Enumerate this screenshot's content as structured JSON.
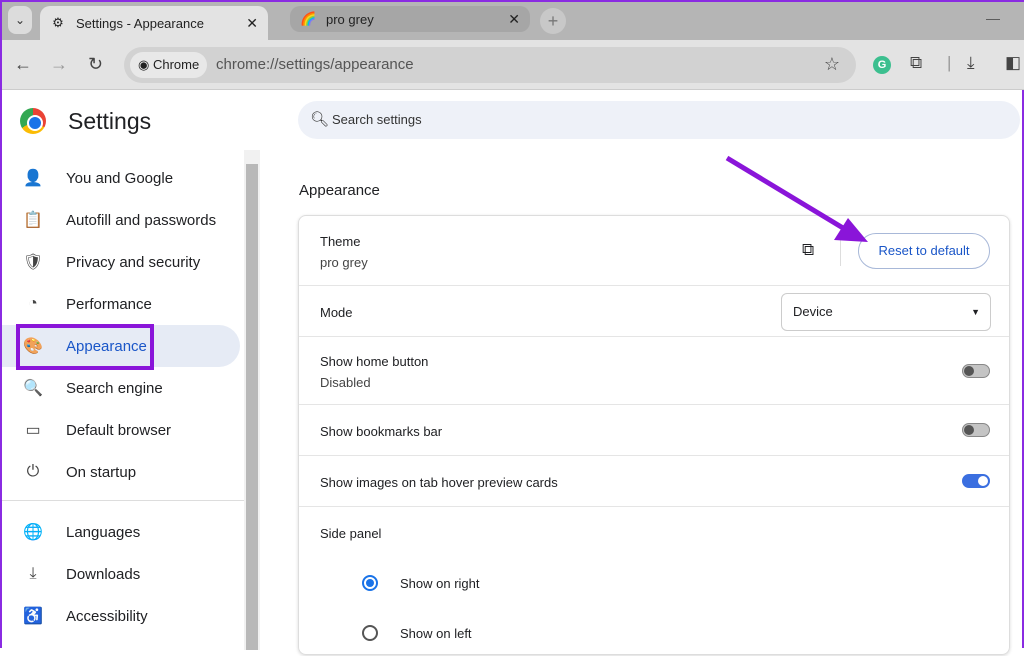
{
  "tabs": [
    {
      "label": "Settings - Appearance",
      "icon": "gear-icon"
    },
    {
      "label": "pro grey",
      "icon": "theme-icon"
    }
  ],
  "toolbar": {
    "chip": "Chrome",
    "url": "chrome://settings/appearance"
  },
  "sidebar": {
    "title": "Settings",
    "items": [
      {
        "label": "You and Google",
        "icon": "👤"
      },
      {
        "label": "Autofill and passwords",
        "icon": "📋"
      },
      {
        "label": "Privacy and security",
        "icon": "🛡"
      },
      {
        "label": "Performance",
        "icon": "◔"
      },
      {
        "label": "Appearance",
        "icon": "🎨"
      },
      {
        "label": "Search engine",
        "icon": "🔍"
      },
      {
        "label": "Default browser",
        "icon": "▭"
      },
      {
        "label": "On startup",
        "icon": "⏻"
      },
      {
        "label": "Languages",
        "icon": "🌐"
      },
      {
        "label": "Downloads",
        "icon": "⤓"
      },
      {
        "label": "Accessibility",
        "icon": "♿"
      }
    ]
  },
  "search": {
    "placeholder": "Search settings"
  },
  "section": {
    "title": "Appearance"
  },
  "theme": {
    "label": "Theme",
    "value": "pro grey",
    "reset": "Reset to default"
  },
  "mode": {
    "label": "Mode",
    "value": "Device"
  },
  "home": {
    "label": "Show home button",
    "value": "Disabled",
    "on": false
  },
  "bookmarks": {
    "label": "Show bookmarks bar",
    "on": false
  },
  "hover": {
    "label": "Show images on tab hover preview cards",
    "on": true
  },
  "sidepanel": {
    "label": "Side panel",
    "options": [
      "Show on right",
      "Show on left"
    ],
    "selected": "Show on right"
  },
  "colors": {
    "accent": "#1a56c8",
    "annotation": "#8a15d9"
  }
}
